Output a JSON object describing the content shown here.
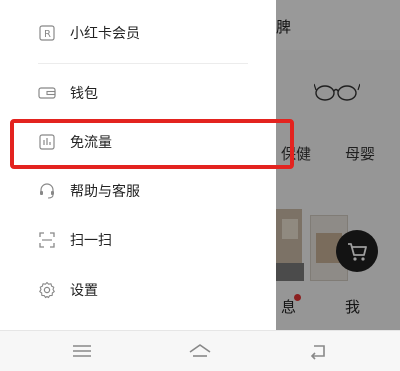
{
  "background": {
    "topbar_char": "脾",
    "categories": [
      "保健",
      "母婴"
    ],
    "bottom_tabs": [
      "息",
      "我"
    ],
    "icons": [
      "glasses-product-icon",
      "cart-icon"
    ]
  },
  "drawer": {
    "items": [
      {
        "label": "小红卡会员",
        "icon": "r-card-icon"
      },
      {
        "label": "钱包",
        "icon": "wallet-icon"
      },
      {
        "label": "免流量",
        "icon": "data-free-icon"
      },
      {
        "label": "帮助与客服",
        "icon": "headset-icon"
      },
      {
        "label": "扫一扫",
        "icon": "scan-icon"
      },
      {
        "label": "设置",
        "icon": "gear-icon"
      }
    ]
  },
  "highlight": {
    "color": "#e3231f",
    "target": "免流量"
  },
  "navbar": {
    "icons": [
      "menu-icon",
      "home-icon",
      "back-icon"
    ]
  }
}
